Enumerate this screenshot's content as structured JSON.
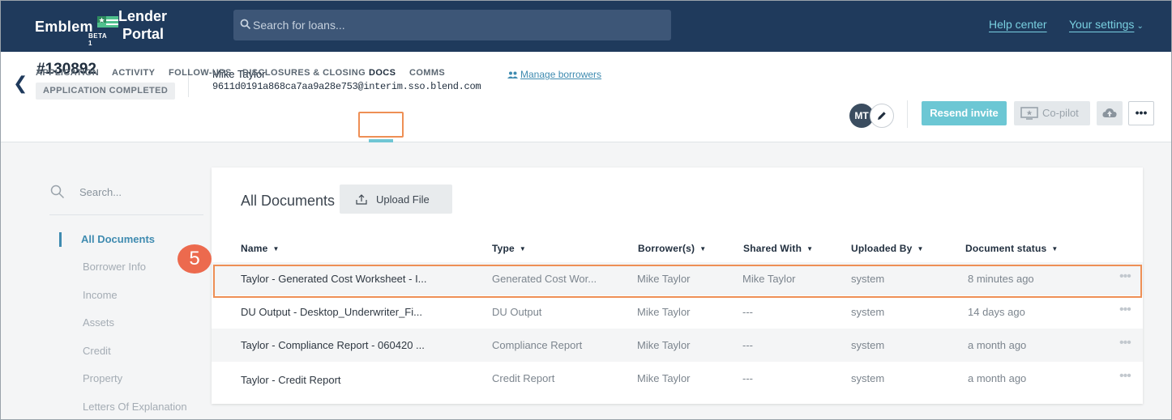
{
  "topbar": {
    "logo_left": "Emblem",
    "logo_beta": "BETA 1",
    "logo_lender": "Lender",
    "logo_portal": "Portal",
    "search_placeholder": "Search for loans...",
    "help_center": "Help center",
    "your_settings": "Your settings"
  },
  "loan": {
    "number": "#130892",
    "status": "APPLICATION COMPLETED",
    "borrower_name": "Mike Taylor",
    "borrower_email": "9611d0191a868ca7aa9a28e753@interim.sso.blend.com",
    "manage_borrowers": "Manage borrowers",
    "avatar_initials": "MT",
    "resend_invite": "Resend invite",
    "copilot": "Co-pilot",
    "more": "•••"
  },
  "tabs": [
    {
      "label": "APPLICATION"
    },
    {
      "label": "ACTIVITY"
    },
    {
      "label": "FOLLOW-UPS"
    },
    {
      "label": "DISCLOSURES & CLOSING"
    },
    {
      "label": "DOCS",
      "active": true
    },
    {
      "label": "COMMS"
    }
  ],
  "sidebar": {
    "search_placeholder": "Search...",
    "items": [
      {
        "label": "All Documents",
        "active": true
      },
      {
        "label": "Borrower Info"
      },
      {
        "label": "Income"
      },
      {
        "label": "Assets"
      },
      {
        "label": "Credit"
      },
      {
        "label": "Property"
      },
      {
        "label": "Letters Of Explanation"
      }
    ]
  },
  "documents": {
    "title": "All Documents",
    "upload_label": "Upload File",
    "columns": [
      "Name",
      "Type",
      "Borrower(s)",
      "Shared With",
      "Uploaded By",
      "Document status"
    ],
    "rows": [
      {
        "name": "Taylor - Generated Cost Worksheet - I...",
        "type": "Generated Cost Wor...",
        "borrowers": "Mike Taylor",
        "shared": "Mike Taylor",
        "uploaded_by": "system",
        "status": "8 minutes ago"
      },
      {
        "name": "DU Output - Desktop_Underwriter_Fi...",
        "type": "DU Output",
        "borrowers": "Mike Taylor",
        "shared": "---",
        "uploaded_by": "system",
        "status": "14 days ago"
      },
      {
        "name": "Taylor - Compliance Report - 060420 ...",
        "type": "Compliance Report",
        "borrowers": "Mike Taylor",
        "shared": "---",
        "uploaded_by": "system",
        "status": "a month ago"
      },
      {
        "name": "Taylor - Credit Report",
        "type": "Credit Report",
        "borrowers": "Mike Taylor",
        "shared": "---",
        "uploaded_by": "system",
        "status": "a month ago"
      }
    ]
  },
  "annotation": {
    "step": "5"
  },
  "colors": {
    "topbar": "#1f3a5c",
    "accent": "#6cc7d4",
    "highlight": "#ee8f55",
    "badge": "#ec6a4e",
    "link": "#3f8bb0"
  }
}
